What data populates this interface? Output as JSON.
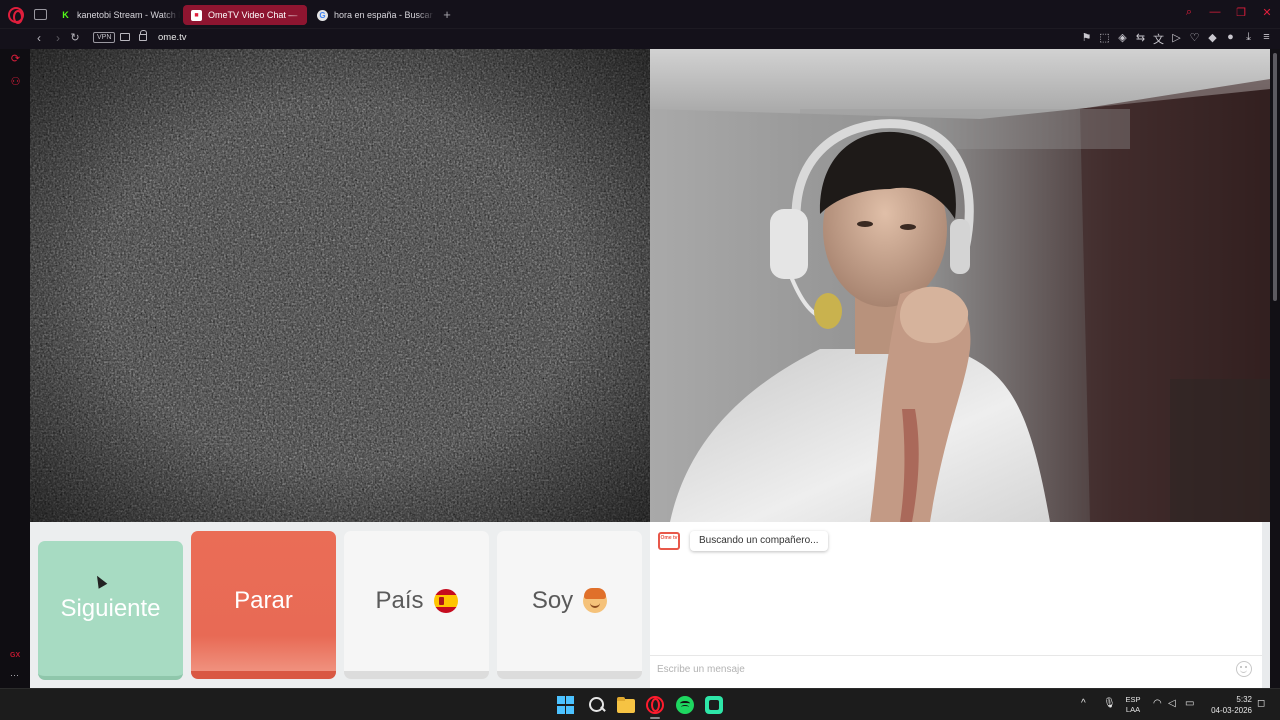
{
  "browser": {
    "tabs": [
      {
        "title": "kanetobi Stream - Watch l",
        "favicon": "kick-icon"
      },
      {
        "title": "OmeTV Video Chat —",
        "favicon": "ometv-icon",
        "active": true
      },
      {
        "title": "hora en españa - Buscar c",
        "favicon": "google-icon"
      }
    ],
    "new_tab": "+",
    "url": "ome.tv",
    "vpn_label": "VPN"
  },
  "sidebar": {
    "gx_label": "GX",
    "more": "···"
  },
  "controls": {
    "next_label": "Siguiente",
    "stop_label": "Parar",
    "country_label": "País",
    "country_flag": "spain-flag-icon",
    "gender_label": "Soy",
    "gender_icon": "boy-emoji-icon"
  },
  "chat": {
    "status_message": "Buscando un compañero...",
    "logo_text": "Ome tv",
    "input_placeholder": "Escribe un mensaje"
  },
  "taskbar": {
    "lang_line1": "ESP",
    "lang_line2": "LAA",
    "time": "5:32",
    "date": "04-03-2026"
  },
  "colors": {
    "opera_red": "#e01e3c",
    "next_button": "#a7dbc2",
    "stop_button": "#e86a55",
    "neutral_button": "#f6f6f6"
  }
}
